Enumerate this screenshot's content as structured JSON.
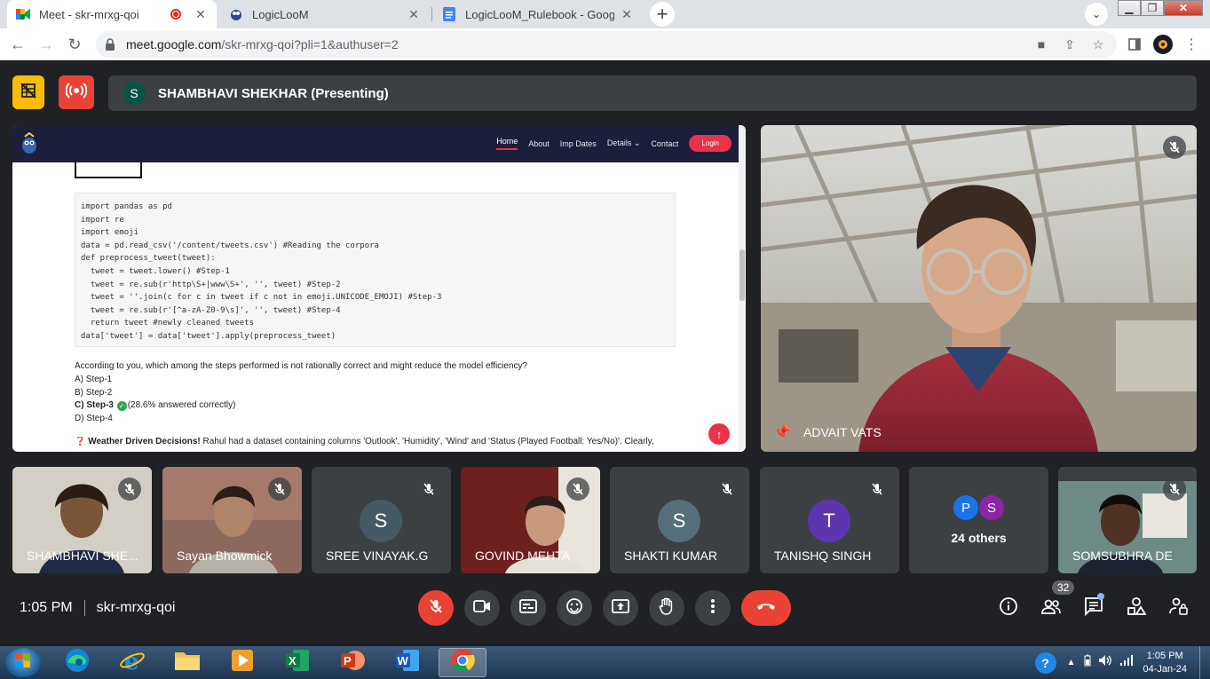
{
  "browser": {
    "tabs": [
      {
        "title": "Meet - skr-mrxg-qoi",
        "active": true
      },
      {
        "title": "LogicLooM",
        "active": false
      },
      {
        "title": "LogicLooM_Rulebook - Google D",
        "active": false
      }
    ],
    "url_host": "meet.google.com",
    "url_path": "/skr-mrxg-qoi?pli=1&authuser=2"
  },
  "meet": {
    "presenter": {
      "initial": "S",
      "label": "SHAMBHAVI SHEKHAR (Presenting)"
    },
    "main_speaker": "ADVAIT VATS",
    "time": "1:05 PM",
    "meeting_code": "skr-mrxg-qoi",
    "participant_count": "32",
    "tiles": [
      {
        "name": "SHAMBHAVI SHE...",
        "video": true
      },
      {
        "name": "Sayan Bhowmick",
        "video": true
      },
      {
        "name": "SREE VINAYAK.G",
        "initial": "S",
        "color": "#455a64"
      },
      {
        "name": "GOVIND MEHTA",
        "video": true
      },
      {
        "name": "SHAKTI KUMAR",
        "initial": "S",
        "color": "#546e7a"
      },
      {
        "name": "TANISHQ SINGH",
        "initial": "T",
        "color": "#5e35b1"
      },
      {
        "name": "24 others",
        "initials": [
          "P",
          "S"
        ]
      },
      {
        "name": "SOMSUBHRA DE",
        "video": true
      }
    ]
  },
  "shared_screen": {
    "nav": [
      "Home",
      "About",
      "Imp Dates",
      "Details",
      "Contact"
    ],
    "login": "Login",
    "code_lines": [
      "import pandas as pd",
      "import re",
      "import emoji",
      "data = pd.read_csv('/content/tweets.csv') #Reading the corpora",
      "def preprocess_tweet(tweet):",
      "  tweet = tweet.lower() #Step-1",
      "  tweet = re.sub(r'http\\S+|www\\S+', '', tweet) #Step-2",
      "  tweet = ''.join(c for c in tweet if c not in emoji.UNICODE_EMOJI) #Step-3",
      "  tweet = re.sub(r'[^a-zA-Z0-9\\s]', '', tweet) #Step-4",
      "  return tweet #newly cleaned tweets",
      "data['tweet'] = data['tweet'].apply(preprocess_tweet)"
    ],
    "question": "According to you, which among the steps performed is not rationally correct and might reduce the model efficiency?",
    "options": [
      "A) Step-1",
      "B) Step-2",
      "C) Step-3",
      "D) Step-4"
    ],
    "answer_note": "(28.6% answered correctly)",
    "next_title": "Weather Driven Decisions!",
    "next_text": " Rahul had a dataset containing columns 'Outlook', 'Humidity', 'Wind' and 'Status (Played Football: Yes/No)'. Clearly,"
  },
  "taskbar": {
    "time": "1:05 PM",
    "date": "04-Jan-24"
  }
}
